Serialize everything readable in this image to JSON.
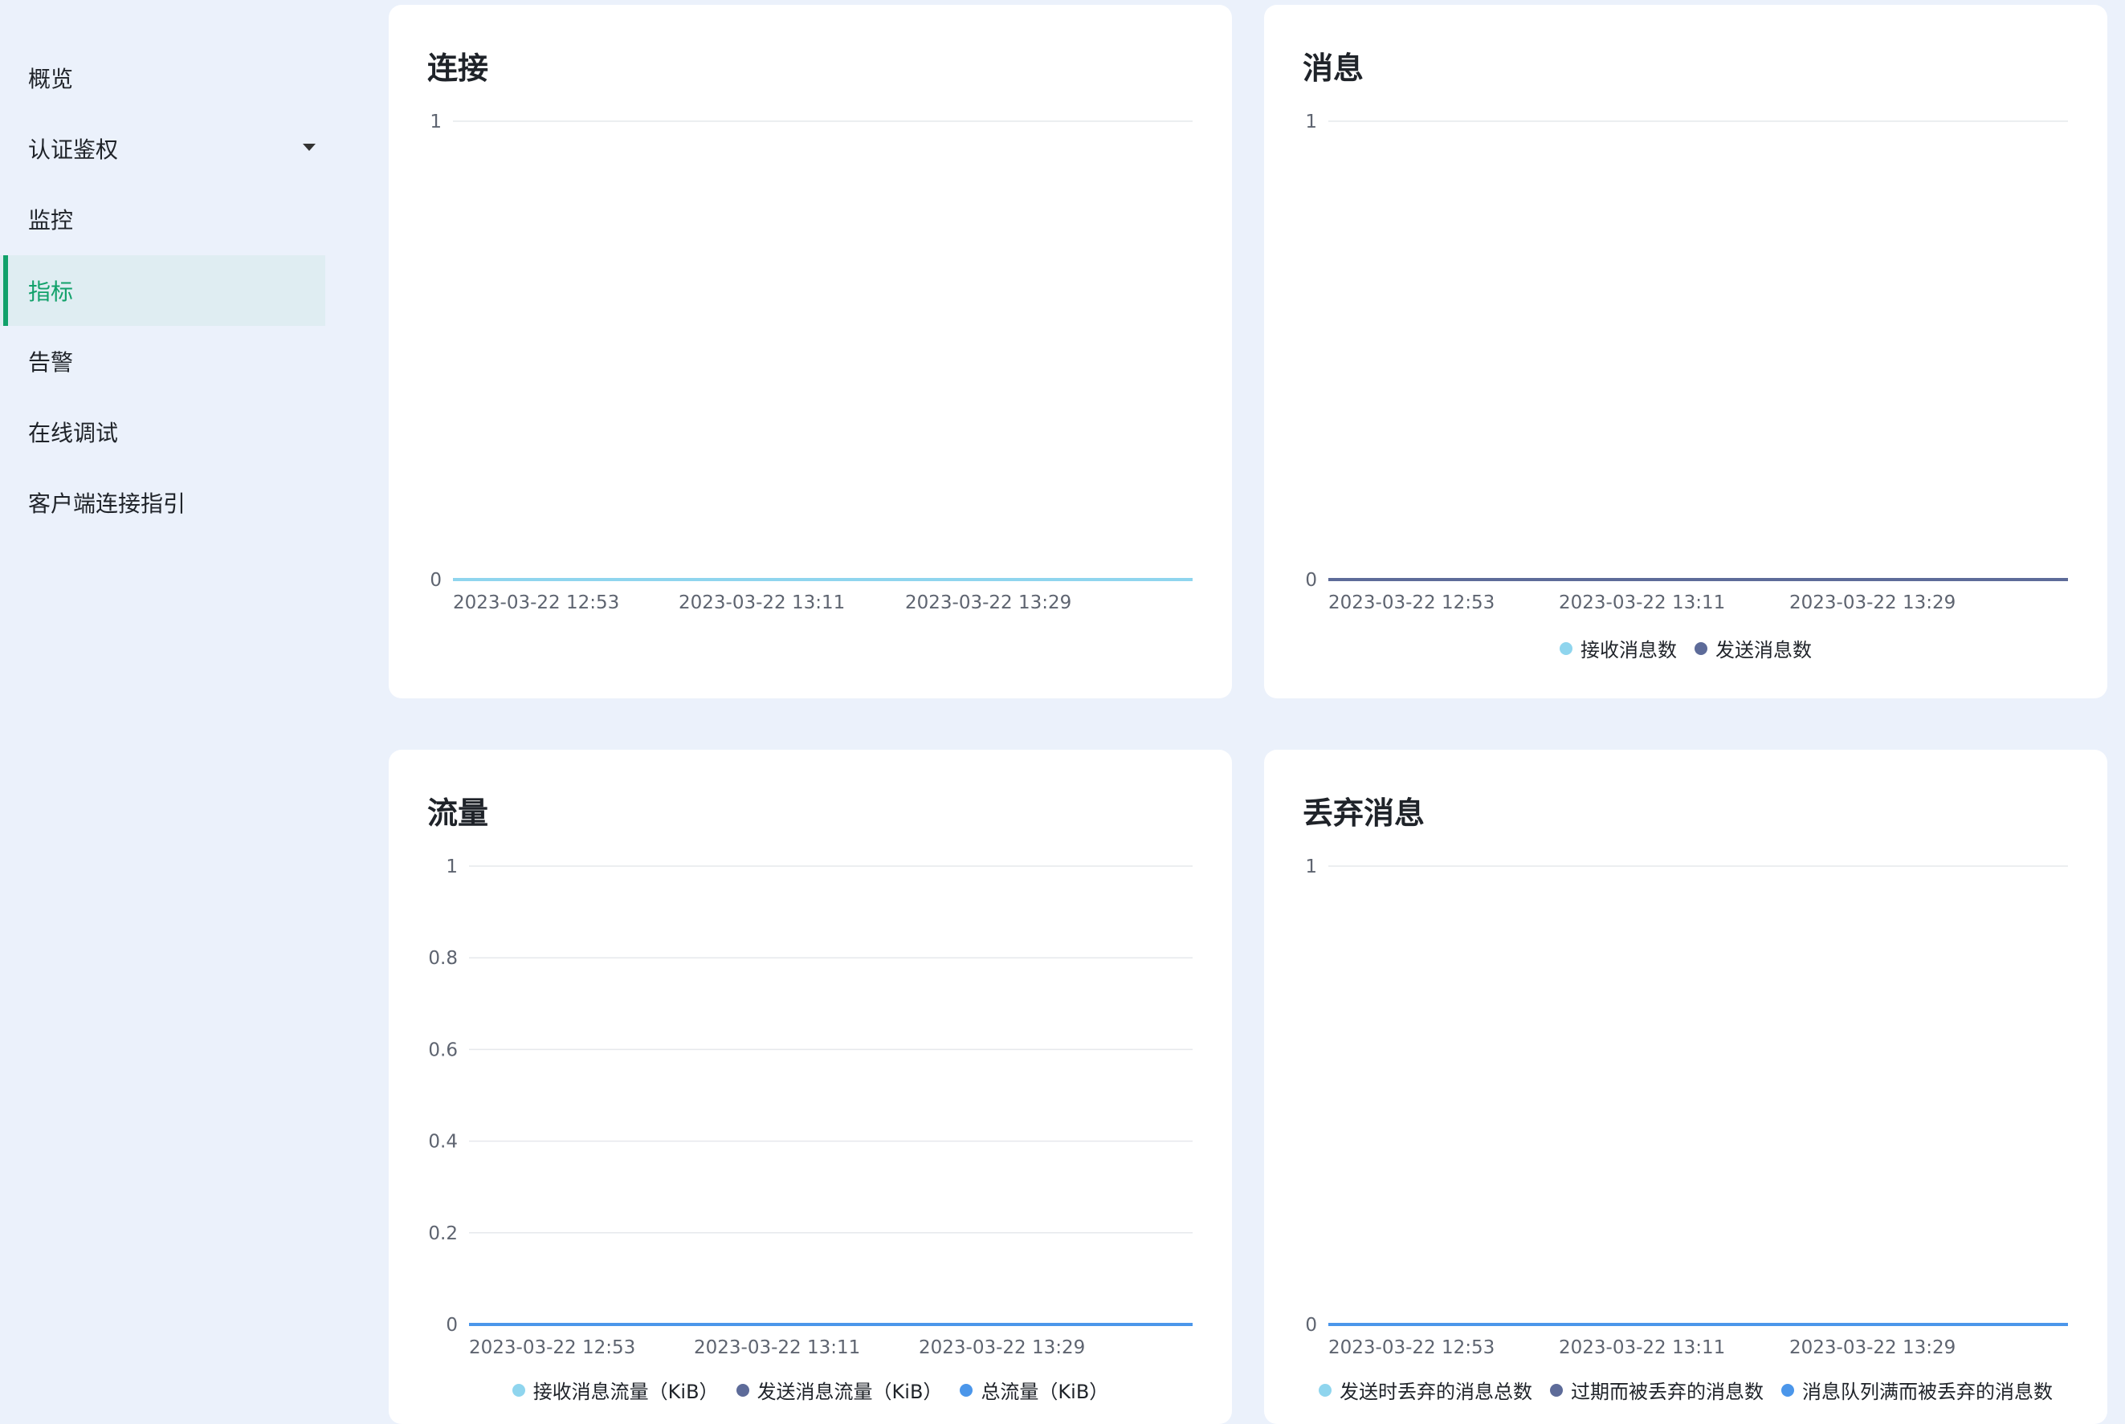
{
  "sidebar": {
    "items": [
      {
        "label": "概览"
      },
      {
        "label": "认证鉴权"
      },
      {
        "label": "监控"
      },
      {
        "label": "指标"
      },
      {
        "label": "告警"
      },
      {
        "label": "在线调试"
      },
      {
        "label": "客户端连接指引"
      }
    ],
    "active_item": "指标",
    "colors": {
      "accent": "#11a16a",
      "active_bg": "#dfedf2"
    }
  },
  "cards": {
    "connections": {
      "title": "连接"
    },
    "messages": {
      "title": "消息"
    },
    "traffic": {
      "title": "流量"
    },
    "dropped": {
      "title": "丢弃消息"
    }
  },
  "chart_data": [
    {
      "id": "connections",
      "type": "line",
      "title": "连接",
      "x": [
        "2023-03-22 12:53",
        "2023-03-22 13:11",
        "2023-03-22 13:29"
      ],
      "x_tick_labels": [
        "2023-03-22 12:53",
        "2023-03-22 13:11",
        "2023-03-22 13:29"
      ],
      "y_ticks": [
        "1",
        "0"
      ],
      "ylim": [
        0,
        1
      ],
      "grid": true,
      "series": [
        {
          "color": "#8fd5ee",
          "values": [
            0,
            0,
            0
          ]
        }
      ],
      "legend": []
    },
    {
      "id": "messages",
      "type": "line",
      "title": "消息",
      "x": [
        "2023-03-22 12:53",
        "2023-03-22 13:11",
        "2023-03-22 13:29"
      ],
      "x_tick_labels": [
        "2023-03-22 12:53",
        "2023-03-22 13:11",
        "2023-03-22 13:29"
      ],
      "y_ticks": [
        "1",
        "0"
      ],
      "ylim": [
        0,
        1
      ],
      "grid": true,
      "series": [
        {
          "name": "接收消息数",
          "color": "#8fd5ee",
          "values": [
            0,
            0,
            0
          ]
        },
        {
          "name": "发送消息数",
          "color": "#5d6b99",
          "values": [
            0,
            0,
            0
          ]
        }
      ],
      "legend": [
        "接收消息数",
        "发送消息数"
      ],
      "legend_position": "bottom"
    },
    {
      "id": "traffic",
      "type": "line",
      "title": "流量",
      "x": [
        "2023-03-22 12:53",
        "2023-03-22 13:11",
        "2023-03-22 13:29"
      ],
      "x_tick_labels": [
        "2023-03-22 12:53",
        "2023-03-22 13:11",
        "2023-03-22 13:29"
      ],
      "y_ticks": [
        "1",
        "0.8",
        "0.6",
        "0.4",
        "0.2",
        "0"
      ],
      "ylim": [
        0,
        1
      ],
      "grid": true,
      "series": [
        {
          "name": "接收消息流量（KiB）",
          "color": "#8fd5ee",
          "values": [
            0,
            0,
            0
          ]
        },
        {
          "name": "发送消息流量（KiB）",
          "color": "#5d6b99",
          "values": [
            0,
            0,
            0
          ]
        },
        {
          "name": "总流量（KiB）",
          "color": "#4b96ea",
          "values": [
            0,
            0,
            0
          ]
        }
      ],
      "legend": [
        "接收消息流量（KiB）",
        "发送消息流量（KiB）",
        "总流量（KiB）"
      ],
      "legend_position": "bottom"
    },
    {
      "id": "dropped",
      "type": "line",
      "title": "丢弃消息",
      "x": [
        "2023-03-22 12:53",
        "2023-03-22 13:11",
        "2023-03-22 13:29"
      ],
      "x_tick_labels": [
        "2023-03-22 12:53",
        "2023-03-22 13:11",
        "2023-03-22 13:29"
      ],
      "y_ticks": [
        "1",
        "0"
      ],
      "ylim": [
        0,
        1
      ],
      "grid": true,
      "series": [
        {
          "name": "发送时丢弃的消息总数",
          "color": "#8fd5ee",
          "values": [
            0,
            0,
            0
          ]
        },
        {
          "name": "过期而被丢弃的消息数",
          "color": "#5d6b99",
          "values": [
            0,
            0,
            0
          ]
        },
        {
          "name": "消息队列满而被丢弃的消息数",
          "color": "#4b96ea",
          "values": [
            0,
            0,
            0
          ]
        }
      ],
      "legend": [
        "发送时丢弃的消息总数",
        "过期而被丢弃的消息数",
        "消息队列满而被丢弃的消息数"
      ],
      "legend_position": "bottom"
    }
  ]
}
